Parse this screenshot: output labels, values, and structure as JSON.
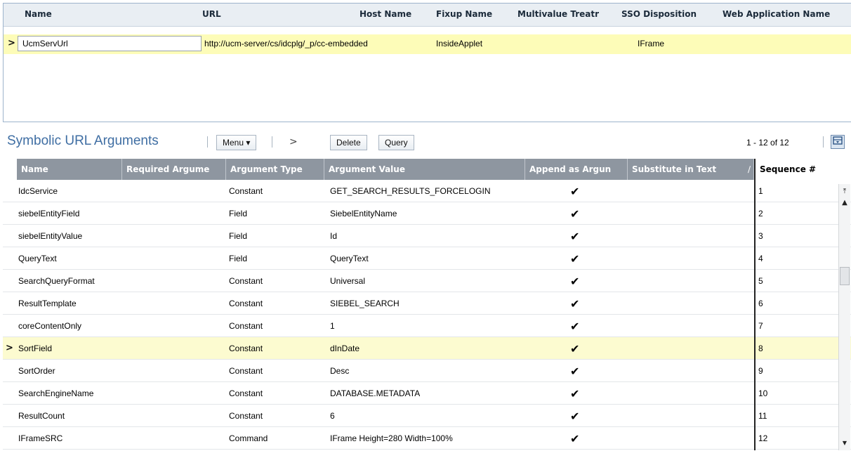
{
  "top_applet": {
    "headers": [
      "Name",
      "URL",
      "Host Name",
      "Fixup Name",
      "Multivalue Treatr",
      "SSO Disposition",
      "Web Application Name"
    ],
    "row": {
      "name": "UcmServUrl",
      "url": "http://ucm-server/cs/idcplg/_p/cc-embedded",
      "fixup_name": "InsideApplet",
      "sso_disposition": "IFrame"
    }
  },
  "arguments_applet": {
    "title": "Symbolic URL Arguments",
    "menu_label": "Menu ▾",
    "nav_next": ">",
    "delete_label": "Delete",
    "query_label": "Query",
    "record_count": "1 - 12 of 12",
    "columns": [
      "Name",
      "Required Argume",
      "Argument Type",
      "Argument Value",
      "Append as Argun",
      "Substitute in Text",
      "Sequence #"
    ],
    "sort_indicator": "∕",
    "rows": [
      {
        "name": "IdcService",
        "type": "Constant",
        "value": "GET_SEARCH_RESULTS_FORCELOGIN",
        "append": "✔",
        "seq": "1"
      },
      {
        "name": "siebelEntityField",
        "type": "Field",
        "value": "SiebelEntityName",
        "append": "✔",
        "seq": "2"
      },
      {
        "name": "siebelEntityValue",
        "type": "Field",
        "value": "Id",
        "append": "✔",
        "seq": "3"
      },
      {
        "name": "QueryText",
        "type": "Field",
        "value": "QueryText",
        "append": "✔",
        "seq": "4"
      },
      {
        "name": "SearchQueryFormat",
        "type": "Constant",
        "value": "Universal",
        "append": "✔",
        "seq": "5"
      },
      {
        "name": "ResultTemplate",
        "type": "Constant",
        "value": "SIEBEL_SEARCH",
        "append": "✔",
        "seq": "6"
      },
      {
        "name": "coreContentOnly",
        "type": "Constant",
        "value": "1",
        "append": "✔",
        "seq": "7"
      },
      {
        "name": "SortField",
        "type": "Constant",
        "value": "dInDate",
        "append": "✔",
        "seq": "8"
      },
      {
        "name": "SortOrder",
        "type": "Constant",
        "value": "Desc",
        "append": "✔",
        "seq": "9"
      },
      {
        "name": "SearchEngineName",
        "type": "Constant",
        "value": "DATABASE.METADATA",
        "append": "✔",
        "seq": "10"
      },
      {
        "name": "ResultCount",
        "type": "Constant",
        "value": "6",
        "append": "✔",
        "seq": "11"
      },
      {
        "name": "IFrameSRC",
        "type": "Command",
        "value": "IFrame Height=280 Width=100%",
        "append": "✔",
        "seq": "12"
      }
    ]
  },
  "row_indicator": ">",
  "icons": {
    "column_chooser": "column-chooser-icon",
    "scroll_top": "⤒",
    "scroll_up": "▲",
    "scroll_down": "▼"
  }
}
